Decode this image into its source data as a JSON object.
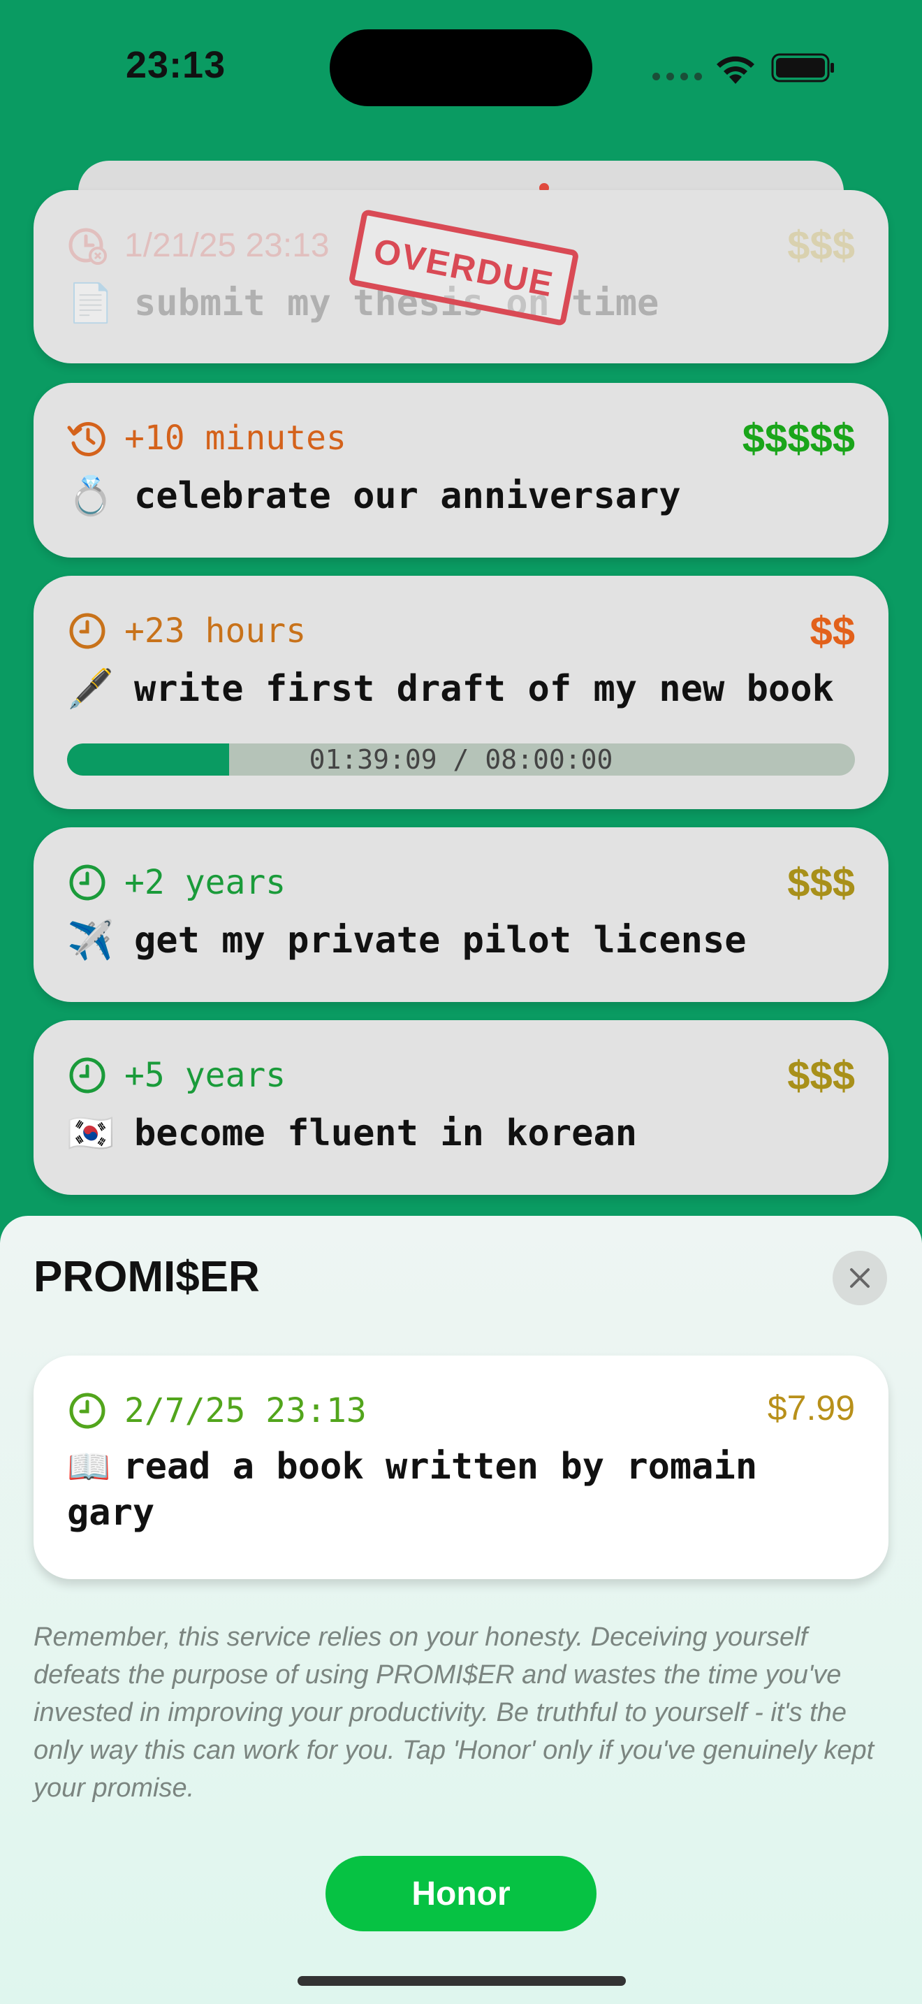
{
  "status_bar": {
    "time": "23:13"
  },
  "cards": [
    {
      "meta": "1/21/25 23:13",
      "price": "$$$",
      "emoji": "📄",
      "title": "submit my thesis on time",
      "stamp": "OVERDUE",
      "meta_color": "#e0807c",
      "price_color": "#c9b252"
    },
    {
      "meta": "+10 minutes",
      "price": "$$$$$",
      "emoji": "💍",
      "title": "celebrate our anniversary",
      "meta_color": "#d4621b",
      "price_color": "#1aa51a"
    },
    {
      "meta": "+23 hours",
      "price": "$$",
      "emoji": "🖋️",
      "title": "write first draft of my new book",
      "progress_label": "01:39:09 / 08:00:00",
      "progress": 0.206,
      "meta_color": "#c8721a",
      "price_color": "#e2611b"
    },
    {
      "meta": "+2 years",
      "price": "$$$",
      "emoji": "✈️",
      "title": "get my private pilot license",
      "meta_color": "#1a9b3a",
      "price_color": "#a8901a"
    },
    {
      "meta": "+5 years",
      "price": "$$$",
      "emoji": "🇰🇷",
      "title": "become fluent in korean",
      "meta_color": "#1a9b3a",
      "price_color": "#a8901a"
    }
  ],
  "sheet": {
    "title": "PROMI$ER",
    "promise": {
      "meta": "2/7/25 23:13",
      "price": "$7.99",
      "emoji": "📖",
      "title": "read a book written by romain gary",
      "meta_color": "#52a51c",
      "price_color": "#b8901a"
    },
    "disclaimer": "Remember, this service relies on your honesty. Deceiving yourself defeats the purpose of using PROMI$ER and wastes the time you've invested in improving your productivity. Be truthful to yourself - it's the only way this can work for you. Tap 'Honor' only if you've genuinely kept your promise.",
    "honor_label": "Honor"
  },
  "colors": {
    "background": "#0a9b62",
    "accent": "#06c243"
  },
  "icons": {
    "clock": "clock-icon",
    "repeat": "history-clock-icon",
    "close": "close-icon",
    "wifi": "wifi-icon",
    "battery": "battery-icon"
  }
}
